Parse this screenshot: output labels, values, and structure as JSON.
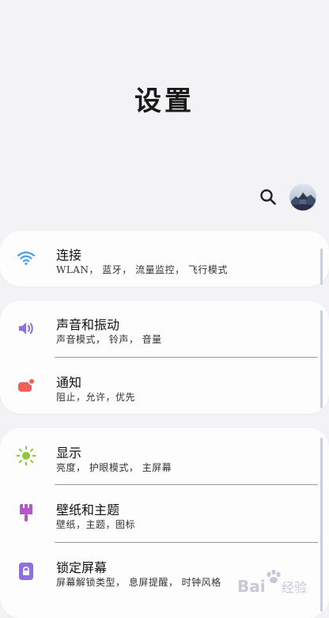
{
  "header": {
    "title": "设置"
  },
  "toolbar": {
    "search_icon": "search-icon",
    "avatar_icon": "profile-avatar"
  },
  "sections": {
    "connections": {
      "icon": "wifi-icon",
      "icon_color": "#4a9fe8",
      "title": "连接",
      "subtitle": "WLAN， 蓝牙， 流量监控， 飞行模式"
    },
    "sound": {
      "icon": "speaker-icon",
      "icon_color": "#8e70e0",
      "title": "声音和振动",
      "subtitle": "声音模式， 铃声， 音量"
    },
    "notifications": {
      "icon": "notification-icon",
      "icon_color": "#f0605a",
      "title": "通知",
      "subtitle": "阻止，允许，优先"
    },
    "display": {
      "icon": "brightness-icon",
      "icon_color": "#8cc83c",
      "title": "显示",
      "subtitle": "亮度， 护眼模式， 主屏幕"
    },
    "wallpaper": {
      "icon": "paintbrush-icon",
      "icon_color": "#b455c8",
      "title": "壁纸和主题",
      "subtitle": "壁纸，主题，图标"
    },
    "lockscreen": {
      "icon": "lock-icon",
      "icon_color": "#8e70e0",
      "title": "锁定屏幕",
      "subtitle": "屏幕解锁类型， 息屏提醒， 时钟风格"
    }
  },
  "watermark": {
    "brand": "Bai",
    "brand_suffix": "经验"
  }
}
